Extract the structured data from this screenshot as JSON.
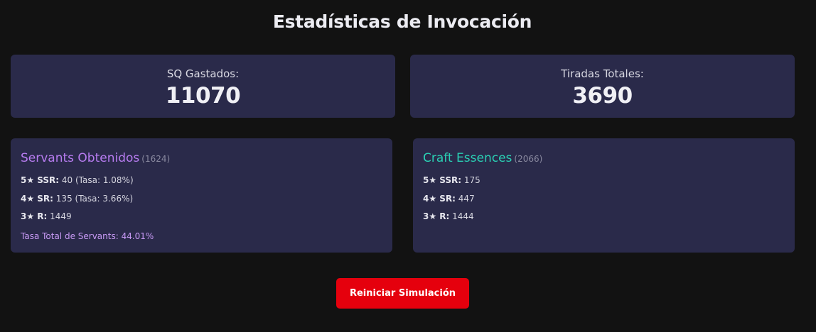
{
  "page": {
    "title": "Estadísticas de Invocación"
  },
  "summary": {
    "sq_label": "SQ Gastados:",
    "sq_value": "11070",
    "rolls_label": "Tiradas Totales:",
    "rolls_value": "3690"
  },
  "servants": {
    "title": "Servants Obtenidos",
    "count": "(1624)",
    "rows": [
      {
        "rank": "5★ SSR:",
        "value": "40 (Tasa: 1.08%)"
      },
      {
        "rank": "4★ SR:",
        "value": "135 (Tasa: 3.66%)"
      },
      {
        "rank": "3★ R:",
        "value": "1449"
      }
    ],
    "total_rate": "Tasa Total de Servants: 44.01%"
  },
  "craft_essences": {
    "title": "Craft Essences",
    "count": "(2066)",
    "rows": [
      {
        "rank": "5★ SSR:",
        "value": "175"
      },
      {
        "rank": "4★ SR:",
        "value": "447"
      },
      {
        "rank": "3★ R:",
        "value": "1444"
      }
    ]
  },
  "actions": {
    "reset_label": "Reiniciar Simulación"
  },
  "colors": {
    "background": "#121212",
    "card": "#2a2a4a",
    "servants_accent": "#b77cf0",
    "ce_accent": "#2ad0b4",
    "button": "#e5000d"
  }
}
